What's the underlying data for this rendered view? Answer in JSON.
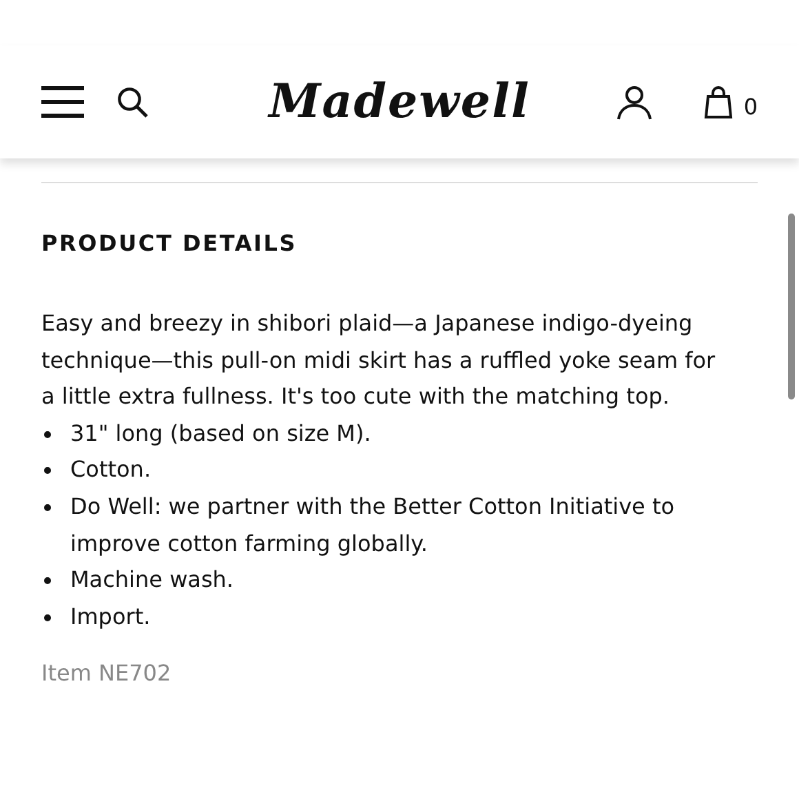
{
  "header": {
    "logo": "Madewell",
    "cart_count": "0"
  },
  "details": {
    "title": "PRODUCT DETAILS",
    "description": "Easy and breezy in shibori plaid—a Japanese indigo-dyeing technique—this pull-on midi skirt has a ruffled yoke seam for a little extra fullness. It's too cute with the matching top.",
    "bullets": [
      "31\" long (based on size M).",
      "Cotton.",
      "Do Well: we partner with the Better Cotton Initiative to improve cotton farming globally.",
      "Machine wash.",
      "Import."
    ],
    "item_number": "Item NE702"
  }
}
